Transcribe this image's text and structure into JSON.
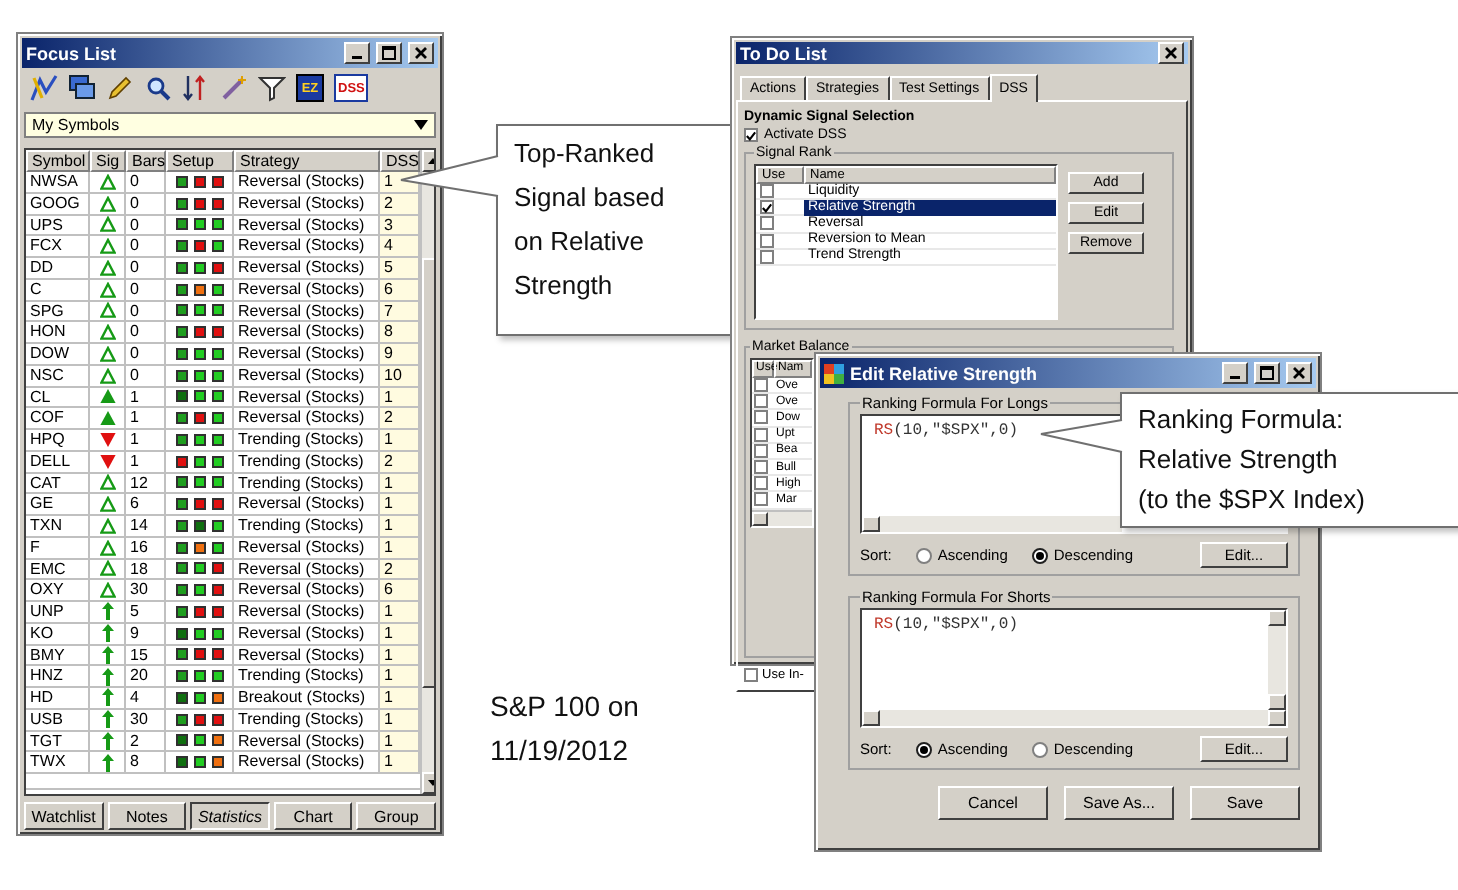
{
  "focus_list": {
    "title": "Focus List",
    "toolbar_labels": [
      "EZ",
      "DSS"
    ],
    "dropdown": {
      "value": "My Symbols"
    },
    "columns": [
      "Symbol",
      "Sig",
      "Bars",
      "Setup",
      "Strategy",
      "DSS"
    ],
    "rows": [
      {
        "symbol": "NWSA",
        "kind": "hollow-up",
        "bars": "0",
        "setup": [
          {
            "color": "#1e9e1e"
          },
          {
            "color": "#e01010"
          },
          {
            "color": "#e01010"
          }
        ],
        "strategy": "Reversal (Stocks)",
        "dss": "1"
      },
      {
        "symbol": "GOOG",
        "kind": "hollow-up",
        "bars": "0",
        "setup": [
          {
            "color": "#1e9e1e"
          },
          {
            "color": "#e01010"
          },
          {
            "color": "#e01010"
          }
        ],
        "strategy": "Reversal (Stocks)",
        "dss": "2"
      },
      {
        "symbol": "UPS",
        "kind": "hollow-up",
        "bars": "0",
        "setup": [
          {
            "color": "#1e9e1e"
          },
          {
            "color": "#22cc22"
          },
          {
            "color": "#22cc22"
          }
        ],
        "strategy": "Reversal (Stocks)",
        "dss": "3"
      },
      {
        "symbol": "FCX",
        "kind": "hollow-up",
        "bars": "0",
        "setup": [
          {
            "color": "#1e9e1e"
          },
          {
            "color": "#e01010"
          },
          {
            "color": "#22cc22"
          }
        ],
        "strategy": "Reversal (Stocks)",
        "dss": "4"
      },
      {
        "symbol": "DD",
        "kind": "hollow-up",
        "bars": "0",
        "setup": [
          {
            "color": "#1e9e1e"
          },
          {
            "color": "#22cc22"
          },
          {
            "color": "#e01010"
          }
        ],
        "strategy": "Reversal (Stocks)",
        "dss": "5"
      },
      {
        "symbol": "C",
        "kind": "hollow-up",
        "bars": "0",
        "setup": [
          {
            "color": "#1e9e1e"
          },
          {
            "color": "#f07010"
          },
          {
            "color": "#22cc22"
          }
        ],
        "strategy": "Reversal (Stocks)",
        "dss": "6"
      },
      {
        "symbol": "SPG",
        "kind": "hollow-up",
        "bars": "0",
        "setup": [
          {
            "color": "#1e9e1e"
          },
          {
            "color": "#22cc22"
          },
          {
            "color": "#22cc22"
          }
        ],
        "strategy": "Reversal (Stocks)",
        "dss": "7"
      },
      {
        "symbol": "HON",
        "kind": "hollow-up",
        "bars": "0",
        "setup": [
          {
            "color": "#1e9e1e"
          },
          {
            "color": "#e01010"
          },
          {
            "color": "#e01010"
          }
        ],
        "strategy": "Reversal (Stocks)",
        "dss": "8"
      },
      {
        "symbol": "DOW",
        "kind": "hollow-up",
        "bars": "0",
        "setup": [
          {
            "color": "#1e9e1e"
          },
          {
            "color": "#22cc22"
          },
          {
            "color": "#22cc22"
          }
        ],
        "strategy": "Reversal (Stocks)",
        "dss": "9"
      },
      {
        "symbol": "NSC",
        "kind": "hollow-up",
        "bars": "0",
        "setup": [
          {
            "color": "#1e9e1e"
          },
          {
            "color": "#22cc22"
          },
          {
            "color": "#22cc22"
          }
        ],
        "strategy": "Reversal (Stocks)",
        "dss": "10"
      },
      {
        "symbol": "CL",
        "kind": "up",
        "bars": "1",
        "setup": [
          {
            "color": "#0f6f0f"
          },
          {
            "color": "#22cc22"
          },
          {
            "color": "#22cc22"
          }
        ],
        "strategy": "Reversal (Stocks)",
        "dss": "1"
      },
      {
        "symbol": "COF",
        "kind": "up",
        "bars": "1",
        "setup": [
          {
            "color": "#1e9e1e"
          },
          {
            "color": "#e01010"
          },
          {
            "color": "#22cc22"
          }
        ],
        "strategy": "Reversal (Stocks)",
        "dss": "2"
      },
      {
        "symbol": "HPQ",
        "kind": "down",
        "bars": "1",
        "setup": [
          {
            "color": "#1e9e1e"
          },
          {
            "color": "#22cc22"
          },
          {
            "color": "#22cc22"
          }
        ],
        "strategy": "Trending (Stocks)",
        "dss": "1"
      },
      {
        "symbol": "DELL",
        "kind": "down",
        "bars": "1",
        "setup": [
          {
            "color": "#e01010"
          },
          {
            "color": "#22cc22"
          },
          {
            "color": "#22cc22"
          }
        ],
        "strategy": "Trending (Stocks)",
        "dss": "2"
      },
      {
        "symbol": "CAT",
        "kind": "hollow-up",
        "bars": "12",
        "setup": [
          {
            "color": "#1e9e1e"
          },
          {
            "color": "#22cc22"
          },
          {
            "color": "#22cc22"
          }
        ],
        "strategy": "Trending (Stocks)",
        "dss": "1"
      },
      {
        "symbol": "GE",
        "kind": "hollow-up",
        "bars": "6",
        "setup": [
          {
            "color": "#1e9e1e"
          },
          {
            "color": "#e01010"
          },
          {
            "color": "#e01010"
          }
        ],
        "strategy": "Reversal (Stocks)",
        "dss": "1"
      },
      {
        "symbol": "TXN",
        "kind": "hollow-up",
        "bars": "14",
        "setup": [
          {
            "color": "#1e9e1e"
          },
          {
            "color": "#0f6f0f"
          },
          {
            "color": "#22cc22"
          }
        ],
        "strategy": "Trending (Stocks)",
        "dss": "1"
      },
      {
        "symbol": "F",
        "kind": "hollow-up",
        "bars": "16",
        "setup": [
          {
            "color": "#1e9e1e"
          },
          {
            "color": "#f07010"
          },
          {
            "color": "#22cc22"
          }
        ],
        "strategy": "Reversal (Stocks)",
        "dss": "1"
      },
      {
        "symbol": "EMC",
        "kind": "hollow-up",
        "bars": "18",
        "setup": [
          {
            "color": "#1e9e1e"
          },
          {
            "color": "#22cc22"
          },
          {
            "color": "#e01010"
          }
        ],
        "strategy": "Reversal (Stocks)",
        "dss": "2"
      },
      {
        "symbol": "OXY",
        "kind": "hollow-up",
        "bars": "30",
        "setup": [
          {
            "color": "#1e9e1e"
          },
          {
            "color": "#22cc22"
          },
          {
            "color": "#e01010"
          }
        ],
        "strategy": "Reversal (Stocks)",
        "dss": "6"
      },
      {
        "symbol": "UNP",
        "kind": "arrow-up",
        "bars": "5",
        "setup": [
          {
            "color": "#1e9e1e"
          },
          {
            "color": "#e01010"
          },
          {
            "color": "#e01010"
          }
        ],
        "strategy": "Reversal (Stocks)",
        "dss": "1"
      },
      {
        "symbol": "KO",
        "kind": "arrow-up",
        "bars": "9",
        "setup": [
          {
            "color": "#0f6f0f"
          },
          {
            "color": "#22cc22"
          },
          {
            "color": "#22cc22"
          }
        ],
        "strategy": "Reversal (Stocks)",
        "dss": "1"
      },
      {
        "symbol": "BMY",
        "kind": "arrow-up",
        "bars": "15",
        "setup": [
          {
            "color": "#1e9e1e"
          },
          {
            "color": "#e01010"
          },
          {
            "color": "#e01010"
          }
        ],
        "strategy": "Reversal (Stocks)",
        "dss": "1"
      },
      {
        "symbol": "HNZ",
        "kind": "arrow-up",
        "bars": "20",
        "setup": [
          {
            "color": "#1e9e1e"
          },
          {
            "color": "#22cc22"
          },
          {
            "color": "#22cc22"
          }
        ],
        "strategy": "Trending (Stocks)",
        "dss": "1"
      },
      {
        "symbol": "HD",
        "kind": "arrow-up",
        "bars": "4",
        "setup": [
          {
            "color": "#0f6f0f"
          },
          {
            "color": "#22cc22"
          },
          {
            "color": "#f07010"
          }
        ],
        "strategy": "Breakout (Stocks)",
        "dss": "1"
      },
      {
        "symbol": "USB",
        "kind": "arrow-up",
        "bars": "30",
        "setup": [
          {
            "color": "#1e9e1e"
          },
          {
            "color": "#e01010"
          },
          {
            "color": "#e01010"
          }
        ],
        "strategy": "Trending (Stocks)",
        "dss": "1"
      },
      {
        "symbol": "TGT",
        "kind": "arrow-up",
        "bars": "2",
        "setup": [
          {
            "color": "#0f6f0f"
          },
          {
            "color": "#22cc22"
          },
          {
            "color": "#f07010"
          }
        ],
        "strategy": "Reversal (Stocks)",
        "dss": "1"
      },
      {
        "symbol": "TWX",
        "kind": "arrow-up",
        "bars": "8",
        "setup": [
          {
            "color": "#0f6f0f"
          },
          {
            "color": "#22cc22"
          },
          {
            "color": "#f07010"
          }
        ],
        "strategy": "Reversal (Stocks)",
        "dss": "1"
      }
    ],
    "tabs": [
      {
        "label": "Watchlist",
        "selected": false
      },
      {
        "label": "Notes",
        "selected": false
      },
      {
        "label": "Statistics",
        "selected": true
      },
      {
        "label": "Chart",
        "selected": false
      },
      {
        "label": "Group",
        "selected": false
      }
    ]
  },
  "callouts": [
    {
      "lines": [
        "Top-Ranked",
        "Signal based",
        "on Relative",
        "Strength"
      ]
    },
    {
      "lines": [
        "Ranking Formula:",
        "Relative Strength",
        "(to the $SPX Index)"
      ]
    }
  ],
  "note": {
    "lines": [
      "S&P 100 on",
      "11/19/2012"
    ]
  },
  "todo_window": {
    "title": "To Do List",
    "tabs": [
      {
        "label": "Actions",
        "selected": false
      },
      {
        "label": "Strategies",
        "selected": false
      },
      {
        "label": "Test Settings",
        "selected": false
      },
      {
        "label": "DSS",
        "selected": true
      }
    ],
    "section_title": "Dynamic Signal Selection",
    "activate": {
      "label": "Activate DSS",
      "checked": true
    },
    "signal_rank": {
      "title": "Signal Rank",
      "columns": [
        "Use",
        "Name"
      ],
      "rows": [
        {
          "name": "Liquidity",
          "checked": false,
          "selected": false
        },
        {
          "name": "Relative Strength",
          "checked": true,
          "selected": true
        },
        {
          "name": "Reversal",
          "checked": false,
          "selected": false
        },
        {
          "name": "Reversion to Mean",
          "checked": false,
          "selected": false
        },
        {
          "name": "Trend Strength",
          "checked": false,
          "selected": false
        }
      ],
      "buttons": [
        "Add",
        "Edit",
        "Remove"
      ]
    },
    "market_balance": {
      "title": "Market Balance",
      "columns": [
        "Use",
        "Nam"
      ],
      "rows": [
        {
          "name": "Ove",
          "checked": false
        },
        {
          "name": "Ove",
          "checked": false
        },
        {
          "name": "Dow",
          "checked": false
        },
        {
          "name": "Upt",
          "checked": false
        },
        {
          "name": "Bea",
          "checked": false
        },
        {
          "name": "Bull",
          "checked": false
        },
        {
          "name": "High",
          "checked": false
        },
        {
          "name": "Mar",
          "checked": false
        }
      ]
    },
    "use_in": {
      "label": "Use In-",
      "checked": false
    }
  },
  "edit_dialog": {
    "title": "Edit Relative Strength",
    "sections": [
      {
        "title": "Ranking Formula For Longs",
        "formula": [
          {
            "text": "RS",
            "kind": "function"
          },
          {
            "text": "(10,\"$SPX\",0)",
            "kind": "plain"
          }
        ],
        "sort_label": "Sort:",
        "options": [
          {
            "label": "Ascending",
            "selected": false
          },
          {
            "label": "Descending",
            "selected": true
          }
        ],
        "edit_button": "Edit..."
      },
      {
        "title": "Ranking Formula For Shorts",
        "formula": [
          {
            "text": "RS",
            "kind": "function"
          },
          {
            "text": "(10,\"$SPX\",0)",
            "kind": "plain"
          }
        ],
        "sort_label": "Sort:",
        "options": [
          {
            "label": "Ascending",
            "selected": true
          },
          {
            "label": "Descending",
            "selected": false
          }
        ],
        "edit_button": "Edit..."
      }
    ],
    "buttons": [
      "Cancel",
      "Save As...",
      "Save"
    ]
  }
}
